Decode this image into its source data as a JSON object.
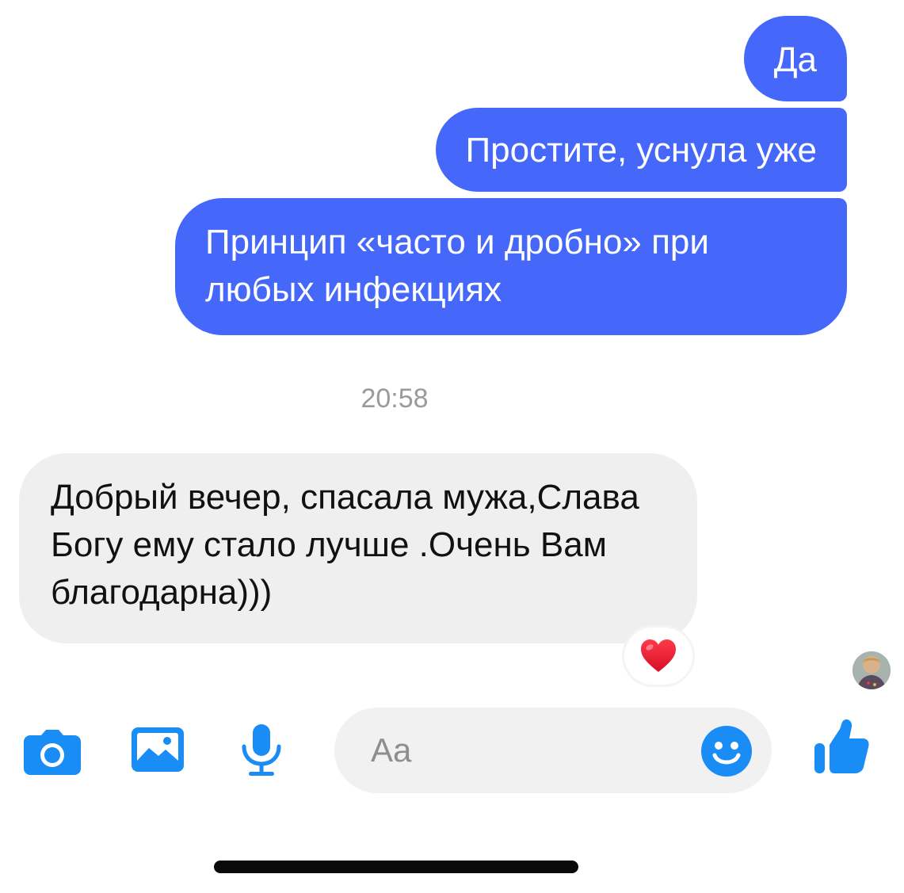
{
  "conversation": {
    "outgoing": [
      {
        "text": "Да"
      },
      {
        "text": "Простите, уснула уже"
      },
      {
        "text": "Принцип «часто и дробно» при любых инфекциях"
      }
    ],
    "timestamp": "20:58",
    "incoming": {
      "text": "Добрый вечер, спасала мужа,Слава Богу ему стало лучше .Очень Вам благодарна)))",
      "reaction": "❤️"
    }
  },
  "composer": {
    "placeholder": "Aa",
    "value": ""
  },
  "icons": {
    "camera": "camera-icon",
    "gallery": "image-icon",
    "microphone": "microphone-icon",
    "emoji": "smiley-icon",
    "like": "thumbs-up-icon"
  },
  "colors": {
    "outgoing_bubble": "#4568fa",
    "incoming_bubble": "#efefef",
    "accent": "#1a8cf5"
  }
}
